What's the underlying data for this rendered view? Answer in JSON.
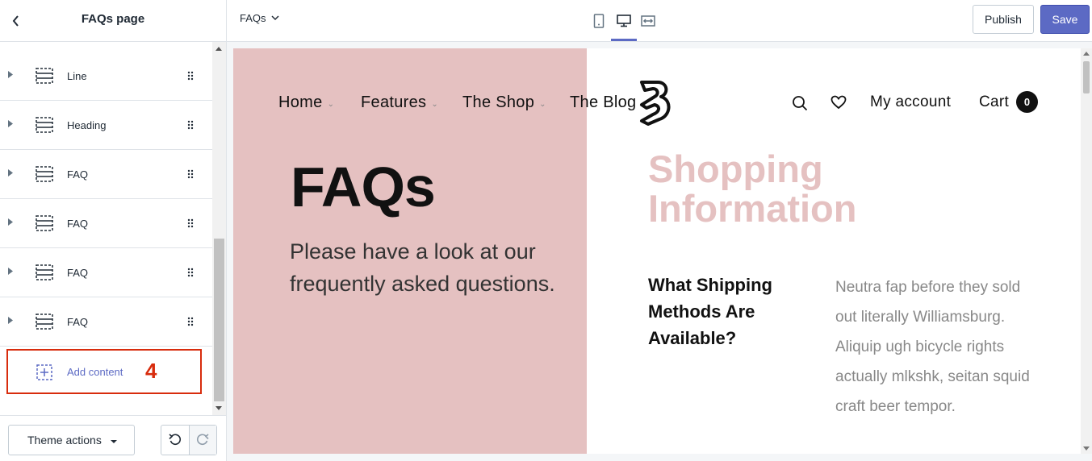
{
  "sidebar": {
    "title": "FAQs page",
    "sections": [
      {
        "label": "Line"
      },
      {
        "label": "Heading"
      },
      {
        "label": "FAQ"
      },
      {
        "label": "FAQ"
      },
      {
        "label": "FAQ"
      },
      {
        "label": "FAQ"
      }
    ],
    "add_content_label": "Add content",
    "step_marker": "4",
    "theme_actions_label": "Theme actions"
  },
  "topbar": {
    "page_selector": "FAQs",
    "publish_label": "Publish",
    "save_label": "Save",
    "active_view": "desktop",
    "accent": "#5c6ac4"
  },
  "preview": {
    "nav": [
      {
        "label": "Home"
      },
      {
        "label": "Features"
      },
      {
        "label": "The Shop"
      },
      {
        "label": "The Blog"
      }
    ],
    "account_label": "My account",
    "cart_label": "Cart",
    "cart_count": "0",
    "hero_title": "FAQs",
    "hero_subtitle": "Please have a look at our frequently asked questions.",
    "section_title": "Shopping Information",
    "question": "What Shipping Methods Are Available?",
    "answer": "Neutra fap before they sold out literally Williamsburg. Aliquip ugh bicycle rights actually mlkshk, seitan squid craft beer tempor.",
    "pink_color": "#e5c1c1"
  }
}
